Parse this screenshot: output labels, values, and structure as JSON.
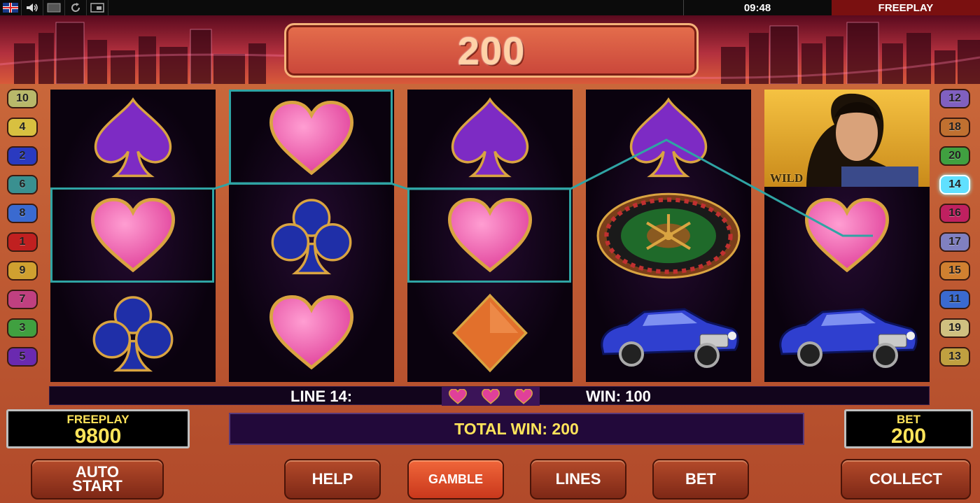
{
  "topbar": {
    "clock": "09:48",
    "mode": "FREEPLAY",
    "icons": [
      "uk-flag-icon",
      "speaker-icon",
      "screen-icon",
      "refresh-icon",
      "window-icon"
    ]
  },
  "header": {
    "win_amount": "200"
  },
  "reels": [
    [
      "spade",
      "heart",
      "club"
    ],
    [
      "heart",
      "club",
      "heart"
    ],
    [
      "spade",
      "heart",
      "diamond"
    ],
    [
      "spade",
      "roulette",
      "car"
    ],
    [
      "wild",
      "heart",
      "car"
    ]
  ],
  "wild_label": "WILD",
  "left_lines": [
    "10",
    "4",
    "2",
    "6",
    "8",
    "1",
    "9",
    "7",
    "3",
    "5"
  ],
  "right_lines": [
    "12",
    "18",
    "20",
    "14",
    "16",
    "17",
    "15",
    "11",
    "19",
    "13"
  ],
  "active_line": "14",
  "line_info": {
    "label": "LINE 14:",
    "win": "WIN: 100"
  },
  "freeplay_panel": {
    "title": "FREEPLAY",
    "value": "9800"
  },
  "total_win": "TOTAL WIN: 200",
  "bet_panel": {
    "title": "BET",
    "value": "200"
  },
  "buttons": {
    "auto_start_1": "AUTO",
    "auto_start_2": "START",
    "help": "HELP",
    "gamble": "GAMBLE",
    "lines": "LINES",
    "bet": "BET",
    "collect": "COLLECT"
  },
  "colors": {
    "highlight": "#2fa4a4",
    "heart": "#e0409a",
    "spade": "#7d2bc4",
    "club": "#1f2fa8",
    "diamond": "#e2702c",
    "gold": "#d9a441",
    "text_yellow": "#ffe45a"
  }
}
